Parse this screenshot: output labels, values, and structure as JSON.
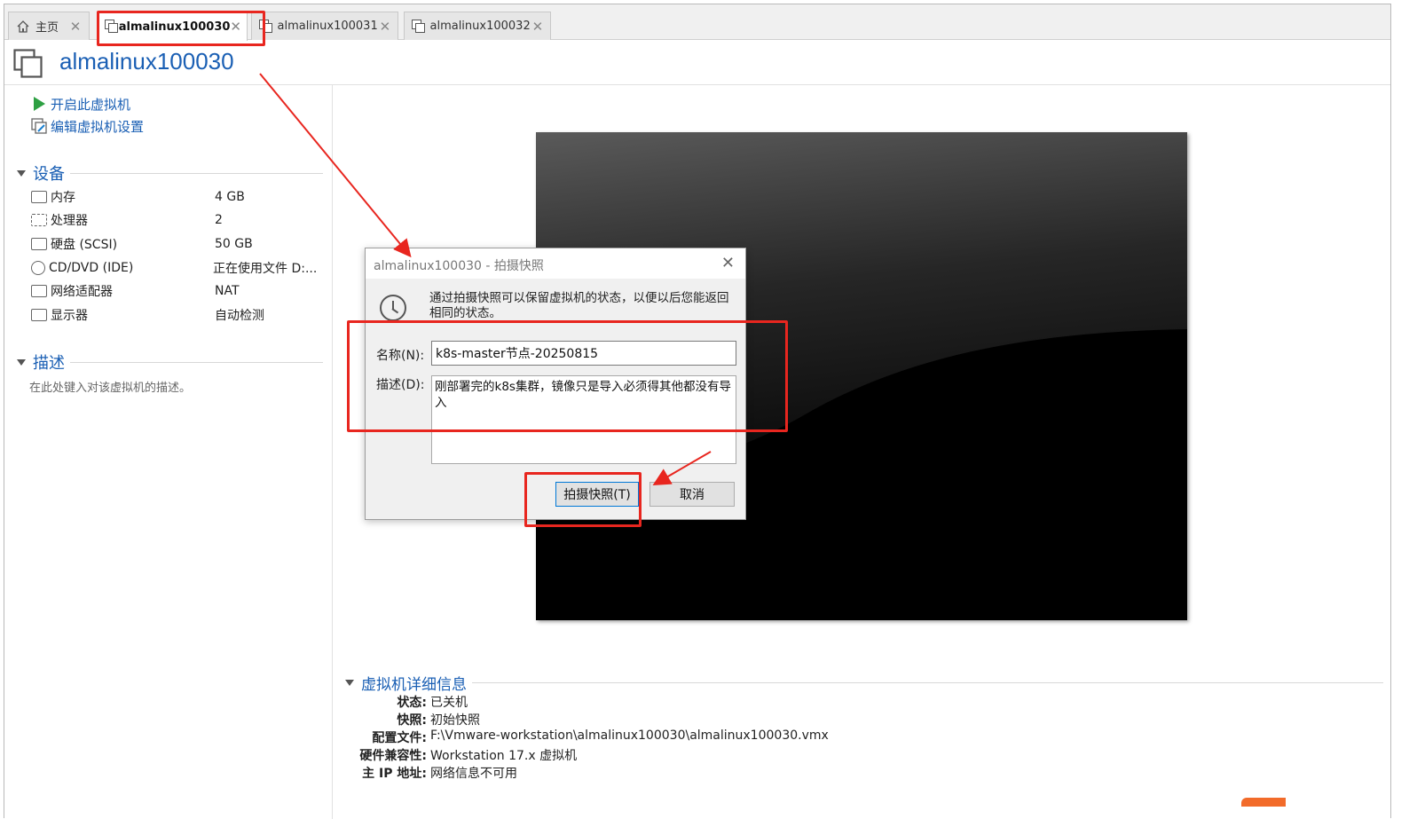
{
  "tabs": [
    {
      "label": "主页"
    },
    {
      "label": "almalinux100030"
    },
    {
      "label": "almalinux100031"
    },
    {
      "label": "almalinux100032"
    }
  ],
  "vm_title": "almalinux100030",
  "actions": {
    "power_on": "开启此虚拟机",
    "edit_settings": "编辑虚拟机设置"
  },
  "devices_section": {
    "title": "设备",
    "items": [
      {
        "name": "内存",
        "value": "4 GB",
        "icon": "memory-icon"
      },
      {
        "name": "处理器",
        "value": "2",
        "icon": "cpu-icon"
      },
      {
        "name": "硬盘 (SCSI)",
        "value": "50 GB",
        "icon": "disk-icon"
      },
      {
        "name": "CD/DVD (IDE)",
        "value": "正在使用文件 D:...",
        "icon": "cd-icon"
      },
      {
        "name": "网络适配器",
        "value": "NAT",
        "icon": "network-icon"
      },
      {
        "name": "显示器",
        "value": "自动检测",
        "icon": "monitor-icon"
      }
    ]
  },
  "description_section": {
    "title": "描述",
    "hint": "在此处键入对该虚拟机的描述。"
  },
  "details": {
    "title": "虚拟机详细信息",
    "rows": [
      {
        "key": "状态:",
        "value": "已关机"
      },
      {
        "key": "快照:",
        "value": "初始快照"
      },
      {
        "key": "配置文件:",
        "value": "F:\\Vmware-workstation\\almalinux100030\\almalinux100030.vmx"
      },
      {
        "key": "硬件兼容性:",
        "value": "Workstation 17.x 虚拟机"
      },
      {
        "key": "主 IP 地址:",
        "value": "网络信息不可用"
      }
    ]
  },
  "dialog": {
    "title": "almalinux100030 - 拍摄快照",
    "message": "通过拍摄快照可以保留虚拟机的状态，以便以后您能返回相同的状态。",
    "name_label": "名称(N):",
    "name_value": "k8s-master节点-20250815",
    "desc_label": "描述(D):",
    "desc_value": "刚部署完的k8s集群，镜像只是导入必须得其他都没有导入",
    "take_button": "拍摄快照(T)",
    "cancel_button": "取消"
  },
  "colors": {
    "accent": "#1a5fb4",
    "annotation": "#e8261f",
    "play": "#2ea043"
  }
}
